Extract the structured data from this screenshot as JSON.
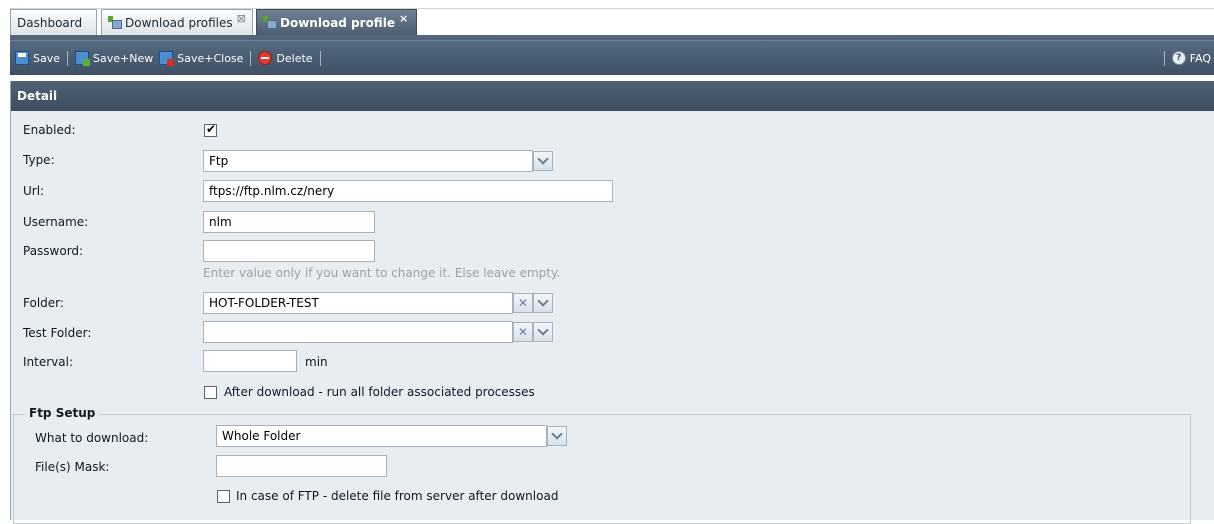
{
  "tabs": [
    {
      "label": "Dashboard"
    },
    {
      "label": "Download profiles",
      "close": "⊠"
    },
    {
      "label": "Download profile",
      "close": "×"
    }
  ],
  "toolbar": {
    "save": "Save",
    "save_new": "Save+New",
    "save_close": "Save+Close",
    "delete": "Delete",
    "faq": "FAQ"
  },
  "panel": {
    "title": "Detail"
  },
  "form": {
    "enabled_label": "Enabled:",
    "enabled_checked": true,
    "type_label": "Type:",
    "type_value": "Ftp",
    "url_label": "Url:",
    "url_value": "ftps://ftp.nlm.cz/nery",
    "username_label": "Username:",
    "username_value": "nlm",
    "password_label": "Password:",
    "password_value": "",
    "password_hint": "Enter value only if you want to change it. Else leave empty.",
    "folder_label": "Folder:",
    "folder_value": "HOT-FOLDER-TEST",
    "test_folder_label": "Test Folder:",
    "test_folder_value": "",
    "interval_label": "Interval:",
    "interval_value": "",
    "interval_unit": "min",
    "after_download_label": "After download - run all folder associated processes",
    "after_download_checked": false
  },
  "ftp_setup": {
    "legend": "Ftp Setup",
    "what_label": "What to download:",
    "what_value": "Whole Folder",
    "mask_label": "File(s) Mask:",
    "mask_value": "",
    "delete_after_label": "In case of FTP - delete file from server after download",
    "delete_after_checked": false
  },
  "colors": {
    "toolbar_bg": "#4a5d71",
    "panel_bg": "#e8edf2",
    "header_bg": "#465869",
    "active_tab_bg": "#5e7083"
  },
  "icons": [
    "profile-icon",
    "save-icon",
    "save-new-icon",
    "save-close-icon",
    "delete-icon",
    "help-icon",
    "chevron-down-icon",
    "clear-icon",
    "checkbox-check-icon"
  ]
}
